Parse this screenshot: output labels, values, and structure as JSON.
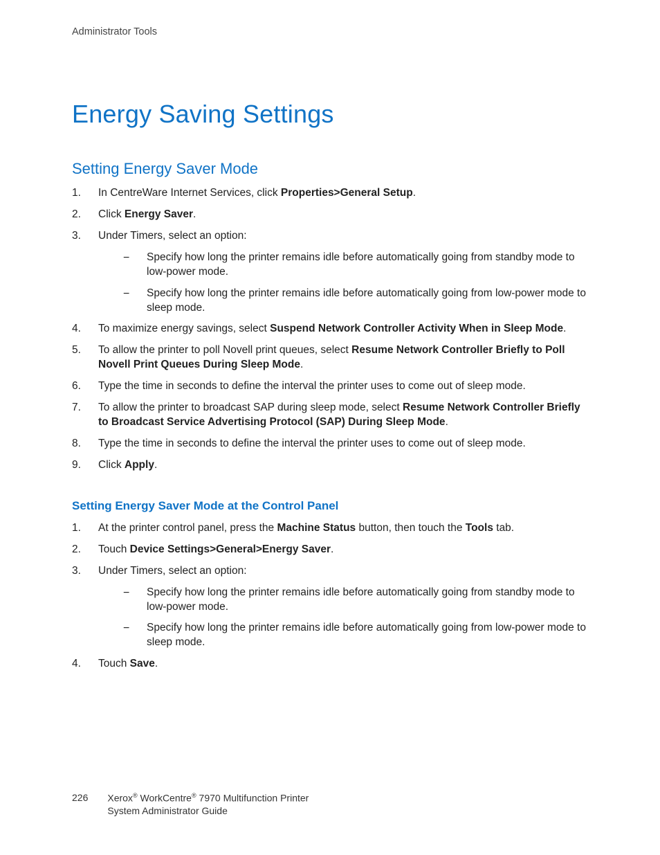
{
  "header": {
    "section": "Administrator Tools"
  },
  "title": "Energy Saving Settings",
  "section1": {
    "heading": "Setting Energy Saver Mode",
    "steps": [
      {
        "pre": "In CentreWare Internet Services, click ",
        "bold": "Properties>General Setup",
        "post": "."
      },
      {
        "pre": "Click ",
        "bold": "Energy Saver",
        "post": "."
      },
      {
        "pre": "Under Timers, select an option:",
        "sub": [
          "Specify how long the printer remains idle before automatically going from standby mode to low-power mode.",
          "Specify how long the printer remains idle before automatically going from low-power mode to sleep mode."
        ]
      },
      {
        "pre": "To maximize energy savings, select ",
        "bold": "Suspend Network Controller Activity When in Sleep Mode",
        "post": "."
      },
      {
        "pre": "To allow the printer to poll Novell print queues, select ",
        "bold": "Resume Network Controller Briefly to Poll Novell Print Queues During Sleep Mode",
        "post": "."
      },
      {
        "pre": "Type the time in seconds to define the interval the printer uses to come out of sleep mode."
      },
      {
        "pre": "To allow the printer to broadcast SAP during sleep mode, select ",
        "bold": "Resume Network Controller Briefly to Broadcast Service Advertising Protocol (SAP) During Sleep Mode",
        "post": "."
      },
      {
        "pre": "Type the time in seconds to define the interval the printer uses to come out of sleep mode."
      },
      {
        "pre": "Click ",
        "bold": "Apply",
        "post": "."
      }
    ]
  },
  "section2": {
    "heading": "Setting Energy Saver Mode at the Control Panel",
    "steps": [
      {
        "pre": "At the printer control panel, press the ",
        "bold": "Machine Status",
        "post": " button, then touch the ",
        "bold2": "Tools",
        "post2": " tab."
      },
      {
        "pre": "Touch ",
        "bold": "Device Settings>General>Energy Saver",
        "post": "."
      },
      {
        "pre": "Under Timers, select an option:",
        "sub": [
          "Specify how long the printer remains idle before automatically going from standby mode to low-power mode.",
          "Specify how long the printer remains idle before automatically going from low-power mode to sleep mode."
        ]
      },
      {
        "pre": "Touch ",
        "bold": "Save",
        "post": "."
      }
    ]
  },
  "footer": {
    "page_number": "226",
    "brand1": "Xerox",
    "brand2": "WorkCentre",
    "model_rest": " 7970 Multifunction Printer",
    "line2": "System Administrator Guide"
  }
}
